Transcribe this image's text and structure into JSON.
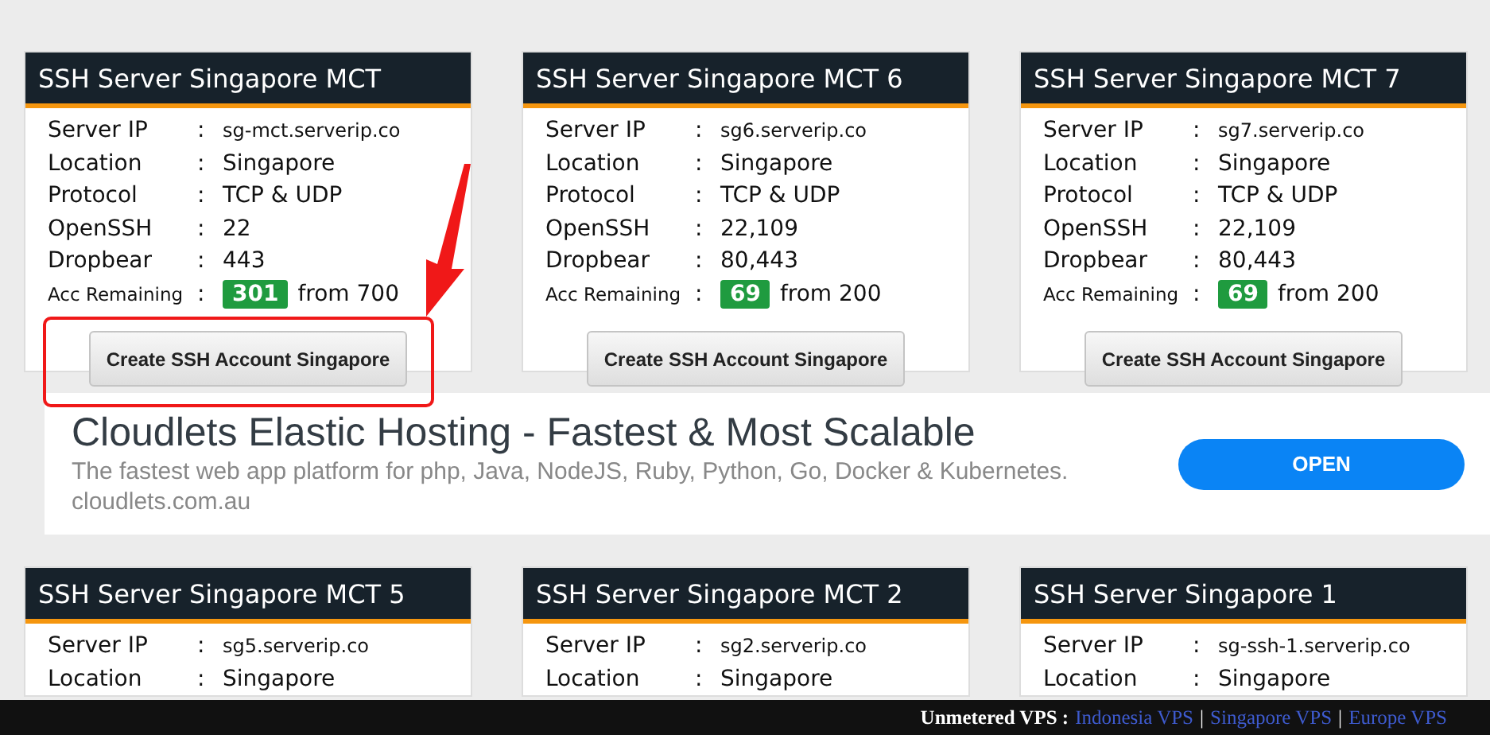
{
  "servers": [
    {
      "title": "SSH Server Singapore MCT",
      "annotated": true,
      "rows": [
        {
          "kind": "host",
          "label": "Server IP",
          "separator": ":",
          "value": "sg-mct.serverip.co"
        },
        {
          "kind": "text",
          "label": "Location",
          "separator": ":",
          "value": "Singapore"
        },
        {
          "kind": "text",
          "label": "Protocol",
          "separator": ":",
          "value": "TCP & UDP"
        },
        {
          "kind": "text",
          "label": "OpenSSH",
          "separator": ":",
          "value": "22"
        },
        {
          "kind": "text",
          "label": "Dropbear",
          "separator": ":",
          "value": "443"
        },
        {
          "kind": "remaining",
          "label": "Acc Remaining",
          "separator": ":",
          "count": "301",
          "value": "from 700"
        }
      ],
      "button": "Create SSH Account Singapore"
    },
    {
      "title": "SSH Server Singapore MCT 6",
      "annotated": false,
      "rows": [
        {
          "kind": "host",
          "label": "Server IP",
          "separator": ":",
          "value": "sg6.serverip.co"
        },
        {
          "kind": "text",
          "label": "Location",
          "separator": ":",
          "value": "Singapore"
        },
        {
          "kind": "text",
          "label": "Protocol",
          "separator": ":",
          "value": "TCP & UDP"
        },
        {
          "kind": "text",
          "label": "OpenSSH",
          "separator": ":",
          "value": "22,109"
        },
        {
          "kind": "text",
          "label": "Dropbear",
          "separator": ":",
          "value": "80,443"
        },
        {
          "kind": "remaining",
          "label": "Acc Remaining",
          "separator": ":",
          "count": "69",
          "value": "from 200"
        }
      ],
      "button": "Create SSH Account Singapore"
    },
    {
      "title": "SSH Server Singapore MCT 7",
      "annotated": false,
      "rows": [
        {
          "kind": "host",
          "label": "Server IP",
          "separator": ":",
          "value": "sg7.serverip.co"
        },
        {
          "kind": "text",
          "label": "Location",
          "separator": ":",
          "value": "Singapore"
        },
        {
          "kind": "text",
          "label": "Protocol",
          "separator": ":",
          "value": "TCP & UDP"
        },
        {
          "kind": "text",
          "label": "OpenSSH",
          "separator": ":",
          "value": "22,109"
        },
        {
          "kind": "text",
          "label": "Dropbear",
          "separator": ":",
          "value": "80,443"
        },
        {
          "kind": "remaining",
          "label": "Acc Remaining",
          "separator": ":",
          "count": "69",
          "value": "from 200"
        }
      ],
      "button": "Create SSH Account Singapore"
    }
  ],
  "ad": {
    "title": "Cloudlets Elastic Hosting - Fastest & Most Scalable",
    "description": "The fastest web app platform for php, Java, NodeJS, Ruby, Python, Go, Docker & Kubernetes.",
    "domain": "cloudlets.com.au",
    "button": "OPEN"
  },
  "more_servers": [
    {
      "title": "SSH Server Singapore MCT 5",
      "rows": [
        {
          "kind": "host",
          "label": "Server IP",
          "separator": ":",
          "value": "sg5.serverip.co"
        },
        {
          "kind": "text",
          "label": "Location",
          "separator": ":",
          "value": "Singapore"
        }
      ]
    },
    {
      "title": "SSH Server Singapore MCT 2",
      "rows": [
        {
          "kind": "host",
          "label": "Server IP",
          "separator": ":",
          "value": "sg2.serverip.co"
        },
        {
          "kind": "text",
          "label": "Location",
          "separator": ":",
          "value": "Singapore"
        }
      ]
    },
    {
      "title": "SSH Server Singapore 1",
      "rows": [
        {
          "kind": "host",
          "label": "Server IP",
          "separator": ":",
          "value": "sg-ssh-1.serverip.co"
        },
        {
          "kind": "text",
          "label": "Location",
          "separator": ":",
          "value": "Singapore"
        }
      ]
    }
  ],
  "footer": {
    "items": [
      {
        "kind": "label",
        "text": "Unmetered VPS :"
      },
      {
        "kind": "link",
        "text": "Indonesia VPS"
      },
      {
        "kind": "separator",
        "text": "|"
      },
      {
        "kind": "link",
        "text": "Singapore VPS"
      },
      {
        "kind": "separator",
        "text": "|"
      },
      {
        "kind": "link",
        "text": "Europe VPS"
      }
    ]
  }
}
